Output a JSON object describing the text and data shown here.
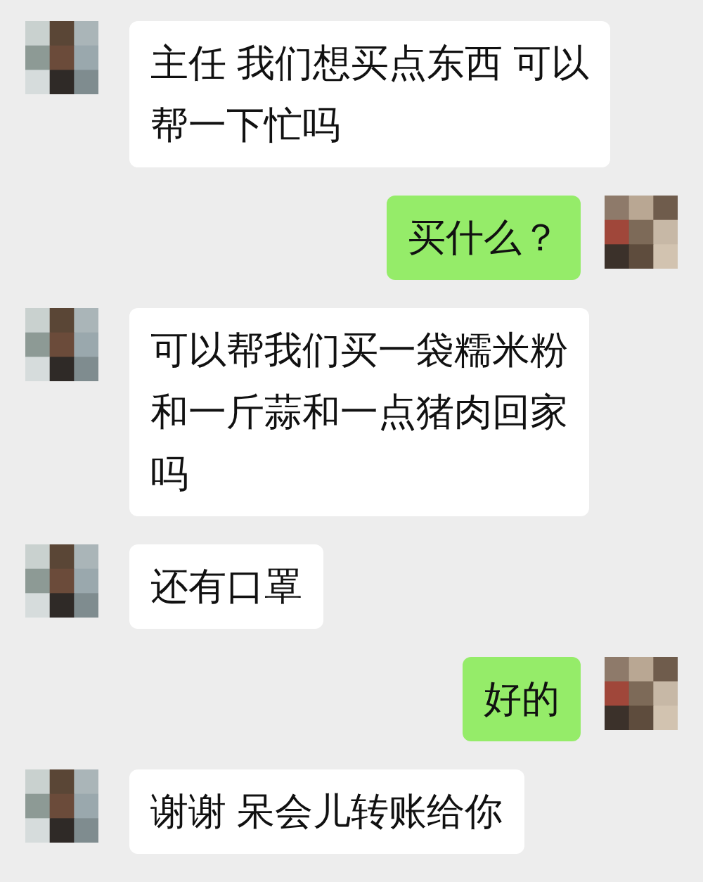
{
  "messages": [
    {
      "kind": "received",
      "lines": [
        "主任 我们想买点东西 可以",
        "帮一下忙吗"
      ]
    },
    {
      "kind": "sent",
      "lines": [
        "买什么？"
      ]
    },
    {
      "kind": "received",
      "lines": [
        "可以帮我们买一袋糯米粉",
        "和一斤蒜和一点猪肉回家",
        "吗"
      ]
    },
    {
      "kind": "received",
      "lines": [
        "还有口罩"
      ]
    },
    {
      "kind": "sent",
      "lines": [
        "好的"
      ]
    },
    {
      "kind": "received",
      "lines": [
        "谢谢 呆会儿转账给你"
      ]
    }
  ]
}
